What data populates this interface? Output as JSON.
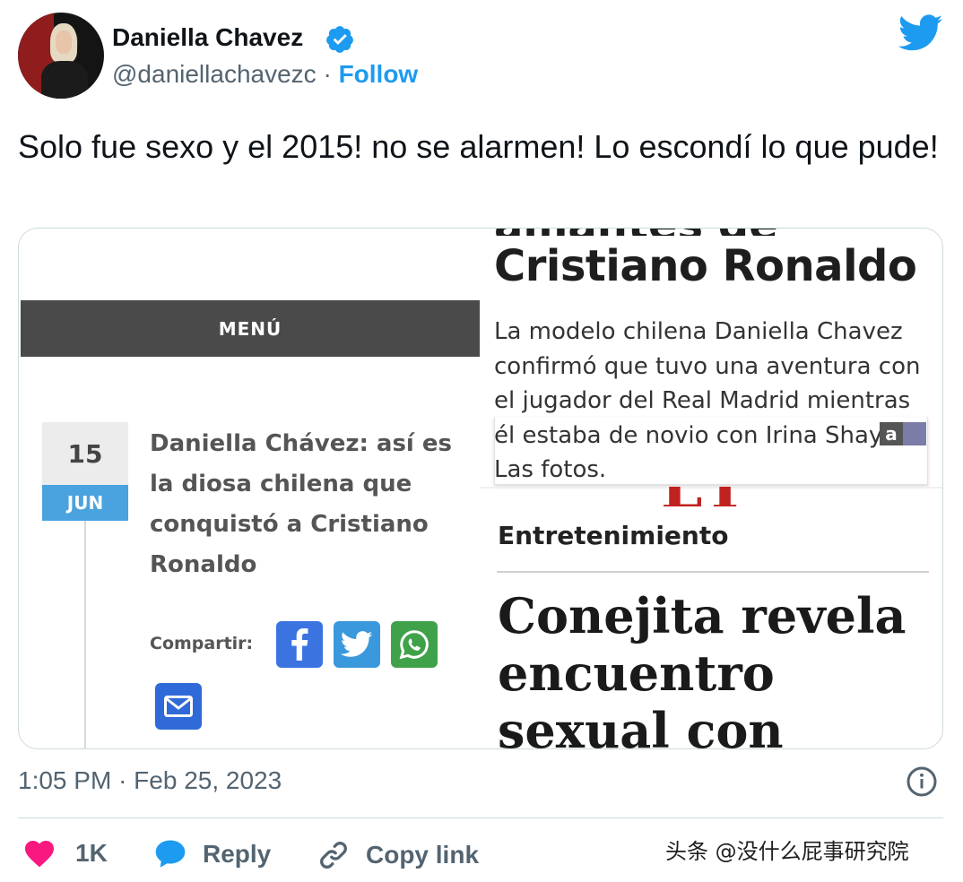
{
  "author": {
    "name": "Daniella Chavez",
    "handle": "@daniellachavezc",
    "separator": "·",
    "follow_label": "Follow",
    "verified_icon": "verified-badge-icon",
    "brand_icon": "twitter-bird-icon",
    "accent_color": "#1d9bf0"
  },
  "tweet": {
    "text": "Solo fue sexo y el 2015! no se alarmen!  Lo escondí lo que pude!"
  },
  "media": {
    "left_article": {
      "menu_label": "MENÚ",
      "date_day": "15",
      "date_month": "JUN",
      "title": "Daniella Chávez: así es la diosa chilena que conquistó a Cristiano Ronaldo",
      "share_label": "Compartir:",
      "share_icons": [
        "facebook-icon",
        "twitter-icon",
        "whatsapp-icon",
        "email-icon"
      ]
    },
    "right_article": {
      "headline_cut": "amantes de",
      "headline": "Cristiano Ronaldo",
      "summary": "La modelo chilena Daniella Chavez confirmó que tuvo una aventura con el jugador del Real Madrid mientras él estaba de novio con Irina Shayk. Las fotos.",
      "ad_badge": "a",
      "section": "Entretenimiento",
      "big_headline": "Conejita revela encuentro sexual con"
    }
  },
  "meta": {
    "time": "1:05 PM",
    "separator": "·",
    "date": "Feb 25, 2023",
    "info_icon": "info-icon"
  },
  "actions": {
    "like_count": "1K",
    "reply_label": "Reply",
    "copy_link_label": "Copy link",
    "like_color": "#f91880"
  },
  "watermark": "头条 @没什么屁事研究院"
}
